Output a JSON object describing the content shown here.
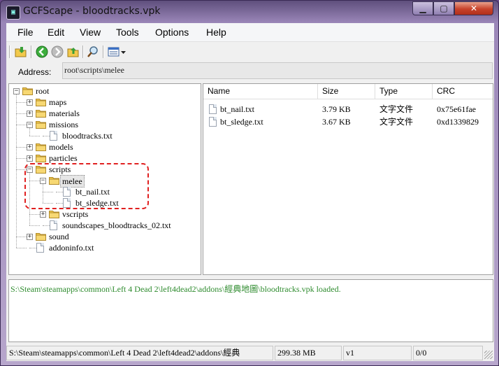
{
  "window": {
    "title": "GCFScape - bloodtracks.vpk",
    "app_icon_text": "GCF"
  },
  "menu": [
    "File",
    "Edit",
    "View",
    "Tools",
    "Options",
    "Help"
  ],
  "address": {
    "label": "Address:",
    "value": "root\\scripts\\melee"
  },
  "tree": [
    {
      "label": "root",
      "type": "folder",
      "depth": 0,
      "expander": "minus"
    },
    {
      "label": "maps",
      "type": "folder",
      "depth": 1,
      "expander": "plus"
    },
    {
      "label": "materials",
      "type": "folder",
      "depth": 1,
      "expander": "plus"
    },
    {
      "label": "missions",
      "type": "folder",
      "depth": 1,
      "expander": "minus"
    },
    {
      "label": "bloodtracks.txt",
      "type": "file",
      "depth": 2,
      "expander": "none"
    },
    {
      "label": "models",
      "type": "folder",
      "depth": 1,
      "expander": "plus"
    },
    {
      "label": "particles",
      "type": "folder",
      "depth": 1,
      "expander": "plus"
    },
    {
      "label": "scripts",
      "type": "folder",
      "depth": 1,
      "expander": "minus"
    },
    {
      "label": "melee",
      "type": "folder",
      "depth": 2,
      "expander": "minus",
      "selected": true
    },
    {
      "label": "bt_nail.txt",
      "type": "file",
      "depth": 3,
      "expander": "none"
    },
    {
      "label": "bt_sledge.txt",
      "type": "file",
      "depth": 3,
      "expander": "none"
    },
    {
      "label": "vscripts",
      "type": "folder",
      "depth": 2,
      "expander": "plus"
    },
    {
      "label": "soundscapes_bloodtracks_02.txt",
      "type": "file",
      "depth": 2,
      "expander": "none"
    },
    {
      "label": "sound",
      "type": "folder",
      "depth": 1,
      "expander": "plus"
    },
    {
      "label": "addoninfo.txt",
      "type": "file",
      "depth": 1,
      "expander": "none"
    }
  ],
  "list": {
    "columns": [
      "Name",
      "Size",
      "Type",
      "CRC"
    ],
    "rows": [
      {
        "name": "bt_nail.txt",
        "size": "3.79 KB",
        "type": "文字文件",
        "crc": "0x75e61fae"
      },
      {
        "name": "bt_sledge.txt",
        "size": "3.67 KB",
        "type": "文字文件",
        "crc": "0xd1339829"
      }
    ]
  },
  "log": {
    "message": "S:\\Steam\\steamapps\\common\\Left 4 Dead 2\\left4dead2\\addons\\經典地圖\\bloodtracks.vpk loaded."
  },
  "status": {
    "path": "S:\\Steam\\steamapps\\common\\Left 4 Dead 2\\left4dead2\\addons\\經典",
    "size": "299.38 MB",
    "version": "v1",
    "count": "0/0"
  },
  "colors": {
    "log_text": "#2e8b2e",
    "highlight": "#e02020",
    "close_button": "#c7412a"
  }
}
